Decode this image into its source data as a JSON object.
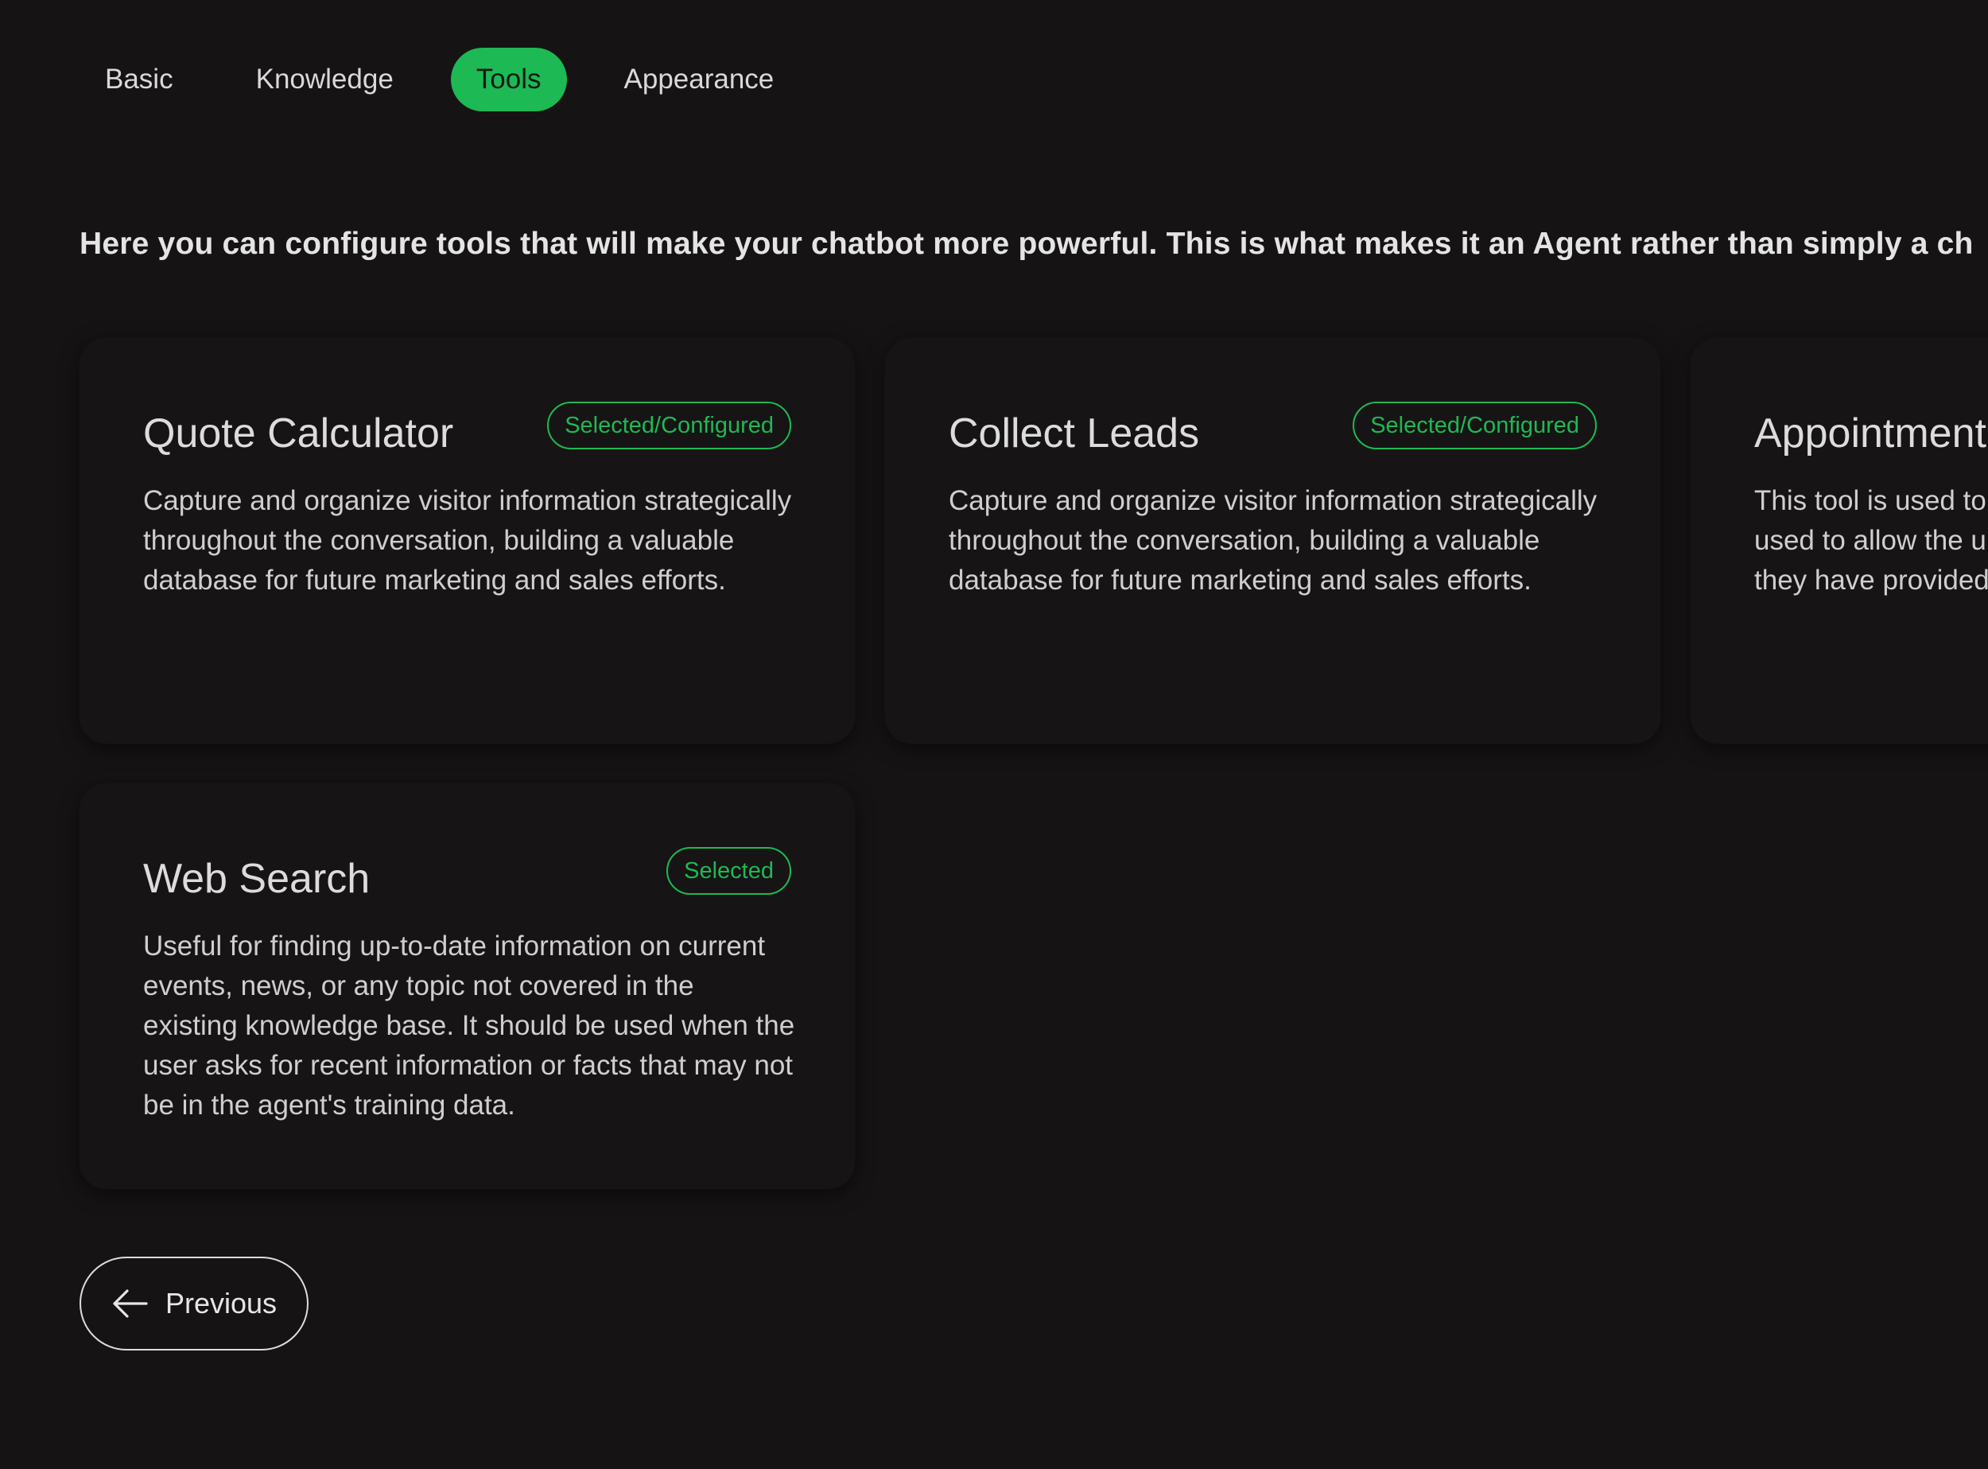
{
  "tabs": [
    {
      "label": "Basic",
      "active": false
    },
    {
      "label": "Knowledge",
      "active": false
    },
    {
      "label": "Tools",
      "active": true
    },
    {
      "label": "Appearance",
      "active": false
    }
  ],
  "intro": "Here you can configure tools that will make your chatbot more powerful. This is what makes it an Agent rather than simply a ch",
  "cards": [
    {
      "title": "Quote Calculator",
      "badge": "Selected/Configured",
      "description": "Capture and organize visitor information strategically throughout the conversation, building a valuable database for future marketing and sales efforts."
    },
    {
      "title": "Collect Leads",
      "badge": "Selected/Configured",
      "description": "Capture and organize visitor information strategically throughout the conversation, building a valuable database for future marketing and sales efforts."
    },
    {
      "title": "Appointment",
      "badge": "",
      "description": "This tool is used to action, such as to s used to allow the u the user has been they have provided"
    },
    {
      "title": "Web Search",
      "badge": "Selected",
      "description": "Useful for finding up-to-date information on current events, news, or any topic not covered in the existing knowledge base. It should be used when the user asks for recent information or facts that may not be in the agent's training data."
    }
  ],
  "previous_button": {
    "label": "Previous",
    "icon": "arrow-left-icon"
  },
  "colors": {
    "background": "#161314",
    "accent": "#1db954",
    "text": "#e6e6e6"
  }
}
